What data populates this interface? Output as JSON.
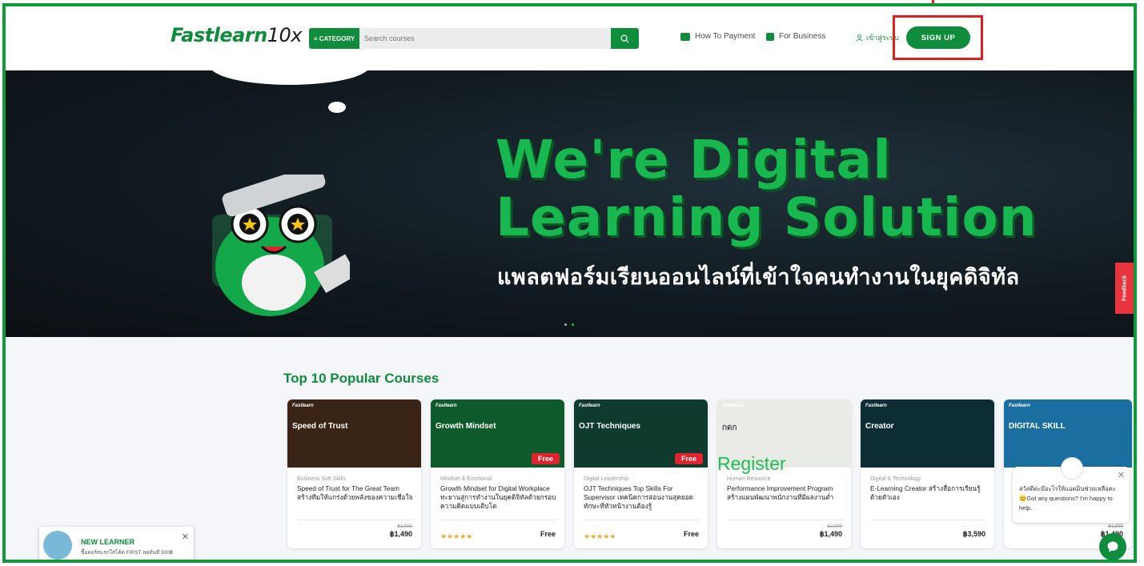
{
  "header": {
    "logo_main": "Fastlearn",
    "logo_suffix": "10x",
    "category_label": "≡ CATEGORY",
    "search_placeholder": "Search courses",
    "how_to_payment": "How To Payment",
    "for_business": "For Business",
    "login": "เข้าสู่ระบบ",
    "signup": "SIGN UP"
  },
  "hero": {
    "title_line1": "We're Digital",
    "title_line2": "Learning Solution",
    "subtitle": "แพลตฟอร์มเรียนออนไลน์ที่เข้าใจคนทำงานในยุคดิจิทัล",
    "feedback": "Feedback"
  },
  "section": {
    "title": "Top 10 Popular Courses"
  },
  "courses": [
    {
      "thumb_title": "Speed of Trust",
      "category": "Business Soft Skills",
      "name": "Speed of Trust for The Great Team สร้างทีมให้แกร่งด้วยพลังของความเชื่อใจ",
      "old_price": "฿1,990",
      "price": "฿1,490",
      "badge": "",
      "stars": "",
      "color": "#3a2416"
    },
    {
      "thumb_title": "Growth Mindset",
      "category": "Mindset & Emotional",
      "name": "Growth Mindset for Digital Workplace ทะยานสู่การทำงานในยุคดิจิทัลด้วยกรอบความคิดแบบเติบโต",
      "old_price": "",
      "price": "Free",
      "badge": "Free",
      "stars": "★★★★★",
      "color": "#0e5a2a"
    },
    {
      "thumb_title": "OJT Techniques",
      "category": "Digital Leadership",
      "name": "OJT Techniques Top Skills For Supervisor เทคนิคการสอนงานสุดยอดทักษะที่หัวหน้างานต้องรู้",
      "old_price": "",
      "price": "Free",
      "badge": "Free",
      "stars": "★★★★★",
      "color": "#0f3a2e"
    },
    {
      "thumb_title": "กดก",
      "category": "Human Resource",
      "name": "Performance Improvement Program สร้างแผนพัฒนาพนักงานที่มีผลงานต่ำ",
      "old_price": "฿2,990",
      "price": "฿1,490",
      "badge": "",
      "stars": "",
      "color": "#e9ebe6"
    },
    {
      "thumb_title": "Creator",
      "category": "Digital & Technology",
      "name": "E-Learning Creator สร้างสื่อการเรียนรู้ด้วยตัวเอง",
      "old_price": "",
      "price": "฿3,590",
      "badge": "",
      "stars": "",
      "color": "#0b2d33"
    },
    {
      "thumb_title": "DIGITAL SKILL",
      "category": "",
      "name": "",
      "old_price": "฿1,990",
      "price": "฿1,490",
      "badge": "",
      "stars": "",
      "color": "#1b6fa0"
    }
  ],
  "register_text": "Register",
  "new_learner": {
    "title": "NEW LEARNER",
    "subtitle": "ซื้อคอร์สแรกใส่โค้ด FIRST ลดทันที 500฿"
  },
  "chat": {
    "message": "สวัสดีค่ะมีอะไรให้แอดมินช่วยเหลือคะ 😊Got any questions? I'm happy to help."
  }
}
